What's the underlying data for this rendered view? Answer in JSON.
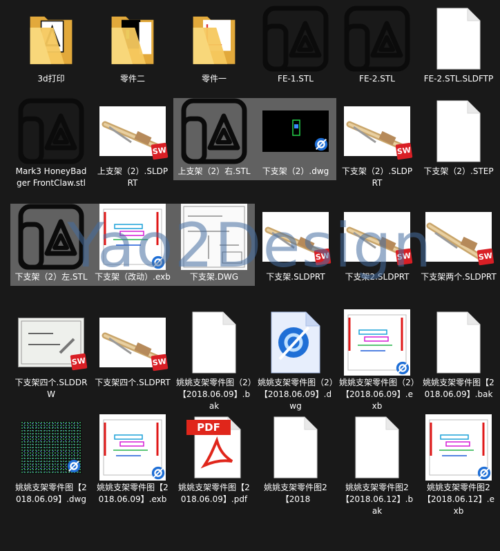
{
  "files": [
    {
      "id": "folder-3d",
      "label": "3d打印",
      "icon": "folder-icon",
      "selected": false
    },
    {
      "id": "folder-part2",
      "label": "零件二",
      "icon": "folder-icon",
      "selected": false
    },
    {
      "id": "folder-part1",
      "label": "零件一",
      "icon": "folder-icon",
      "selected": false
    },
    {
      "id": "fe1",
      "label": "FE-1.STL",
      "icon": "stl-app-icon",
      "selected": false
    },
    {
      "id": "fe2",
      "label": "FE-2.STL",
      "icon": "stl-app-icon",
      "selected": false
    },
    {
      "id": "fe2-sldftp",
      "label": "FE-2.STL.SLDFTP",
      "icon": "blank-file-icon",
      "selected": false
    },
    {
      "id": "mark3",
      "label": "Mark3 HoneyBadger FrontClaw.stl",
      "icon": "stl-app-icon",
      "selected": false
    },
    {
      "id": "upper-sldprt",
      "label": "上支架（2）.SLDPRT",
      "icon": "solidworks-part-thumb",
      "selected": false
    },
    {
      "id": "upper-right-stl",
      "label": "上支架（2）右.STL",
      "icon": "stl-app-icon",
      "selected": true
    },
    {
      "id": "lower-dwg",
      "label": "下支架（2）.dwg",
      "icon": "dwg-dark-thumb",
      "selected": true
    },
    {
      "id": "lower-sldprt",
      "label": "下支架（2）.SLDPRT",
      "icon": "solidworks-part-thumb",
      "selected": false
    },
    {
      "id": "lower-step",
      "label": "下支架（2）.STEP",
      "icon": "blank-file-icon",
      "selected": false
    },
    {
      "id": "lower-left-stl",
      "label": "下支架（2）左.STL",
      "icon": "stl-app-icon",
      "selected": true
    },
    {
      "id": "lower-mod-exb",
      "label": "下支架（改动）.exb",
      "icon": "exb-drawing-thumb",
      "selected": true
    },
    {
      "id": "lower-dwg2",
      "label": "下支架.DWG",
      "icon": "dwg-sheet-thumb",
      "selected": true
    },
    {
      "id": "lower-sldprt2",
      "label": "下支架.SLDPRT",
      "icon": "solidworks-part-thumb",
      "selected": false
    },
    {
      "id": "lower2-sldprt",
      "label": "下支架2.SLDPRT",
      "icon": "solidworks-part-thumb",
      "selected": false
    },
    {
      "id": "lower-two-sldprt",
      "label": "下支架两个.SLDPRT",
      "icon": "solidworks-part-thumb",
      "selected": false
    },
    {
      "id": "lower-four-slddrw",
      "label": "下支架四个.SLDDRW",
      "icon": "solidworks-drawing-thumb",
      "selected": false
    },
    {
      "id": "lower-four-sldprt",
      "label": "下支架四个.SLDPRT",
      "icon": "solidworks-part-thumb",
      "selected": false
    },
    {
      "id": "yy-2-bak",
      "label": "姚姚支架零件图（2）【2018.06.09】.bak",
      "icon": "blank-file-icon",
      "selected": false
    },
    {
      "id": "yy-2-dwg",
      "label": "姚姚支架零件图（2）【2018.06.09】.dwg",
      "icon": "caxa-file-icon",
      "selected": false
    },
    {
      "id": "yy-2-exb",
      "label": "姚姚支架零件图（2）【2018.06.09】.exb",
      "icon": "exb-drawing-thumb",
      "selected": false
    },
    {
      "id": "yy-bak",
      "label": "姚姚支架零件图【2018.06.09】.bak",
      "icon": "blank-file-icon",
      "selected": false
    },
    {
      "id": "yy-dwg",
      "label": "姚姚支架零件图【2018.06.09】.dwg",
      "icon": "dwg-dark-thumb",
      "selected": false
    },
    {
      "id": "yy-exb",
      "label": "姚姚支架零件图【2018.06.09】.exb",
      "icon": "exb-drawing-thumb",
      "selected": false
    },
    {
      "id": "yy-pdf",
      "label": "姚姚支架零件图【2018.06.09】.pdf",
      "icon": "pdf-file-icon",
      "selected": false
    },
    {
      "id": "yy2-2018",
      "label": "姚姚支架零件图2【2018",
      "icon": "blank-file-icon",
      "selected": false
    },
    {
      "id": "yy2-bak",
      "label": "姚姚支架零件图2【2018.06.12】.bak",
      "icon": "blank-file-icon",
      "selected": false
    },
    {
      "id": "yy2-exb",
      "label": "姚姚支架零件图2【2018.06.12】.exb",
      "icon": "exb-drawing-thumb",
      "selected": false
    }
  ],
  "watermark": "Yao2Design",
  "badges": {
    "sw": "SW",
    "pdf": "PDF"
  },
  "colors": {
    "background": "#191919",
    "selection": "#7d7d7d",
    "folder": "#f3c35a",
    "solidworks_red": "#d91f25",
    "pdf_red": "#e0261b",
    "caxa_blue": "#1f6fd6"
  }
}
